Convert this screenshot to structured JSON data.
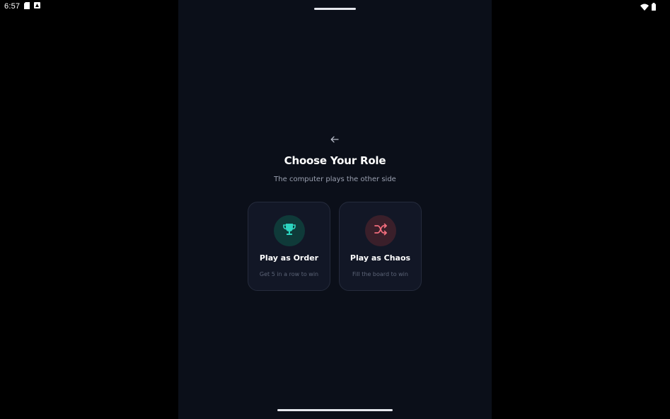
{
  "status_bar": {
    "time": "6:57",
    "left_icons": [
      "sim-card-icon",
      "notification-icon"
    ],
    "right_icons": [
      "wifi-icon",
      "battery-icon"
    ]
  },
  "screen": {
    "back_icon": "arrow-left-icon",
    "title": "Choose Your Role",
    "subtitle": "The computer plays the other side",
    "roles": [
      {
        "label": "Play as Order",
        "description": "Get 5 in a row to win",
        "icon": "trophy-icon",
        "accent": "#2dd4bf",
        "icon_bg": "#0f3a39"
      },
      {
        "label": "Play as Chaos",
        "description": "Fill the board to win",
        "icon": "shuffle-icon",
        "accent": "#f26d7d",
        "icon_bg": "#3a1f2a"
      }
    ]
  },
  "colors": {
    "background": "#0b0f19",
    "card": "#121726",
    "card_border": "#252b3c"
  }
}
